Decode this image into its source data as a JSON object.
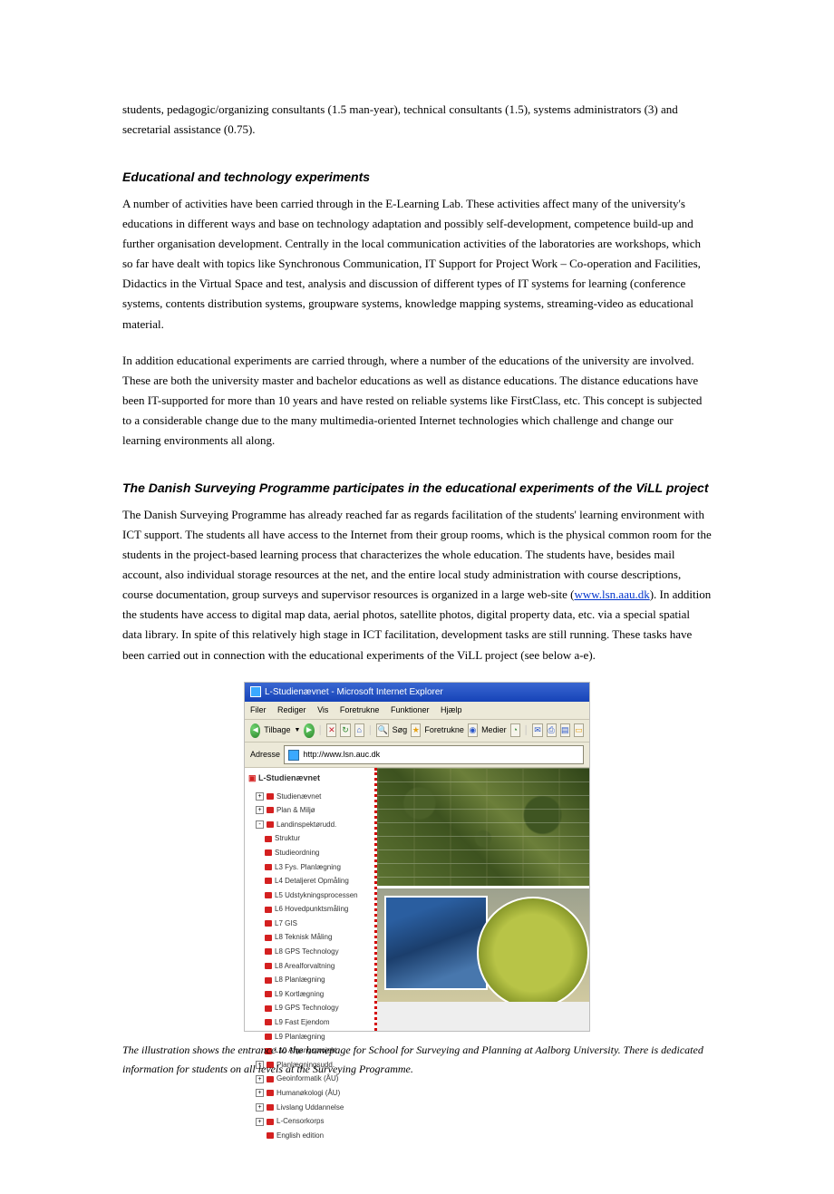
{
  "intro_para": "students, pedagogic/organizing consultants (1.5 man-year), technical consultants (1.5), systems administrators (3) and secretarial assistance (0.75).",
  "h1": "Educational and technology experiments",
  "p1": "A number of activities have been carried through in the E-Learning Lab. These activities affect many of the university's educations in different ways and base on technology adaptation and possibly self-development, competence build-up and further organisation development. Centrally in the local communication activities of the laboratories are workshops, which so far have dealt with topics like Synchronous Communication, IT Support for Project Work – Co-operation and Facilities, Didactics in the Virtual Space and test, analysis and discussion of different types of IT systems for learning (conference systems, contents distribution systems, groupware systems, knowledge mapping systems, streaming-video as educational material.",
  "p2": "In addition educational experiments are carried through, where a number of the educations of the university are involved. These are both the university master and bachelor educations as well as distance educations. The distance educations have been IT-supported for more than 10 years and have rested on reliable systems like FirstClass, etc. This concept is subjected to a considerable change due to the many multimedia-oriented Internet technologies which challenge and change our learning environments all along.",
  "h2": "The Danish Surveying Programme participates in the educational experiments of the ViLL project",
  "p3a": "The Danish Surveying Programme has already reached far as regards facilitation of the students' learning environment with ICT support. The students all have access to the Internet from their group rooms, which is the physical common room for the students in the project-based learning process that characterizes the whole education. The students have, besides mail account, also individual storage resources at the net, and the entire local study administration with course descriptions, course documentation, group surveys and supervisor resources is organized in a large web-site (",
  "link": "www.lsn.aau.dk",
  "p3b": "). In addition the students have access to digital map data, aerial photos, satellite photos, digital property data, etc. via a special spatial data library. In spite of this relatively high stage in ICT facilitation, development tasks are still running. These tasks have been carried out in connection with the educational experiments of the ViLL project (see below a-e).",
  "caption": "The illustration shows the entrance to the homepage for School for Surveying and Planning at Aalborg University. There is dedicated information for students on all levels at the Surveying Programme.",
  "browser": {
    "title": "L-Studienævnet - Microsoft Internet Explorer",
    "menu": [
      "Filer",
      "Rediger",
      "Vis",
      "Foretrukne",
      "Funktioner",
      "Hjælp"
    ],
    "back": "Tilbage",
    "search": "Søg",
    "fav": "Foretrukne",
    "media": "Medier",
    "addr_label": "Adresse",
    "addr_value": "http://www.lsn.auc.dk",
    "side_title": "L-Studienævnet",
    "tree": [
      {
        "lv": 1,
        "toggle": "+",
        "label": "Studienævnet"
      },
      {
        "lv": 1,
        "toggle": "+",
        "label": "Plan & Miljø"
      },
      {
        "lv": 1,
        "toggle": "-",
        "label": "Landinspektørudd."
      },
      {
        "lv": 2,
        "label": "Struktur"
      },
      {
        "lv": 2,
        "label": "Studieordning"
      },
      {
        "lv": 2,
        "label": "L3 Fys. Planlægning"
      },
      {
        "lv": 2,
        "label": "L4 Detaljeret Opmåling"
      },
      {
        "lv": 2,
        "label": "L5 Udstykningsprocessen"
      },
      {
        "lv": 2,
        "label": "L6 Hovedpunktsmåling"
      },
      {
        "lv": 2,
        "label": "L7 GIS"
      },
      {
        "lv": 2,
        "label": "L8 Teknisk Måling"
      },
      {
        "lv": 2,
        "label": "L8 GPS Technology"
      },
      {
        "lv": 2,
        "label": "L8 Arealforvaltning"
      },
      {
        "lv": 2,
        "label": "L8 Planlægning"
      },
      {
        "lv": 2,
        "label": "L9 Kortlægning"
      },
      {
        "lv": 2,
        "label": "L9 GPS Technology"
      },
      {
        "lv": 2,
        "label": "L9 Fast Ejendom"
      },
      {
        "lv": 2,
        "label": "L9 Planlægning"
      },
      {
        "lv": 2,
        "label": "L10 Afgangsprojekt"
      },
      {
        "lv": 1,
        "toggle": "+",
        "label": "Planlægningsudd."
      },
      {
        "lv": 1,
        "toggle": "+",
        "label": "Geoinformatik (ÅU)"
      },
      {
        "lv": 1,
        "toggle": "+",
        "label": "Humanøkologi (ÅU)"
      },
      {
        "lv": 1,
        "toggle": "+",
        "label": "Livslang Uddannelse"
      },
      {
        "lv": 1,
        "toggle": "+",
        "label": "L-Censorkorps"
      },
      {
        "lv": 1,
        "label": "English edition"
      }
    ]
  }
}
